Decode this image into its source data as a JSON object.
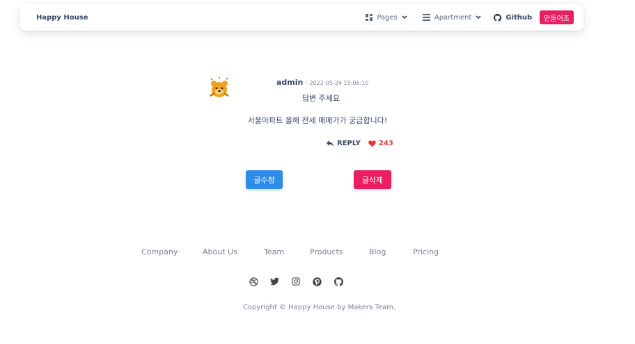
{
  "navbar": {
    "brand": "Happy House",
    "pages_label": "Pages",
    "apartment_label": "Apartment",
    "github_label": "Github",
    "make_button": "만들어조"
  },
  "post": {
    "author": "admin",
    "date": "· 2022-05-24 15:06:10",
    "title": "답변 주세요",
    "body": "서울아파트 올해 전세 매매가가 궁금합니다!",
    "reply_label": "REPLY",
    "like_count": "243",
    "edit_button": "글수정",
    "delete_button": "글삭제"
  },
  "footer": {
    "links": [
      "Company",
      "About Us",
      "Team",
      "Products",
      "Blog",
      "Pricing"
    ],
    "socials": [
      "dribbble-icon",
      "twitter-icon",
      "instagram-icon",
      "pinterest-icon",
      "github-icon"
    ],
    "copyright": "Copyright © Happy House by Makers Team."
  },
  "colors": {
    "accent_pink": "#e91e63",
    "accent_blue": "#2f8ce8",
    "heart_red": "#e53935",
    "text_dark": "#344767",
    "text_muted": "#7b809a"
  }
}
